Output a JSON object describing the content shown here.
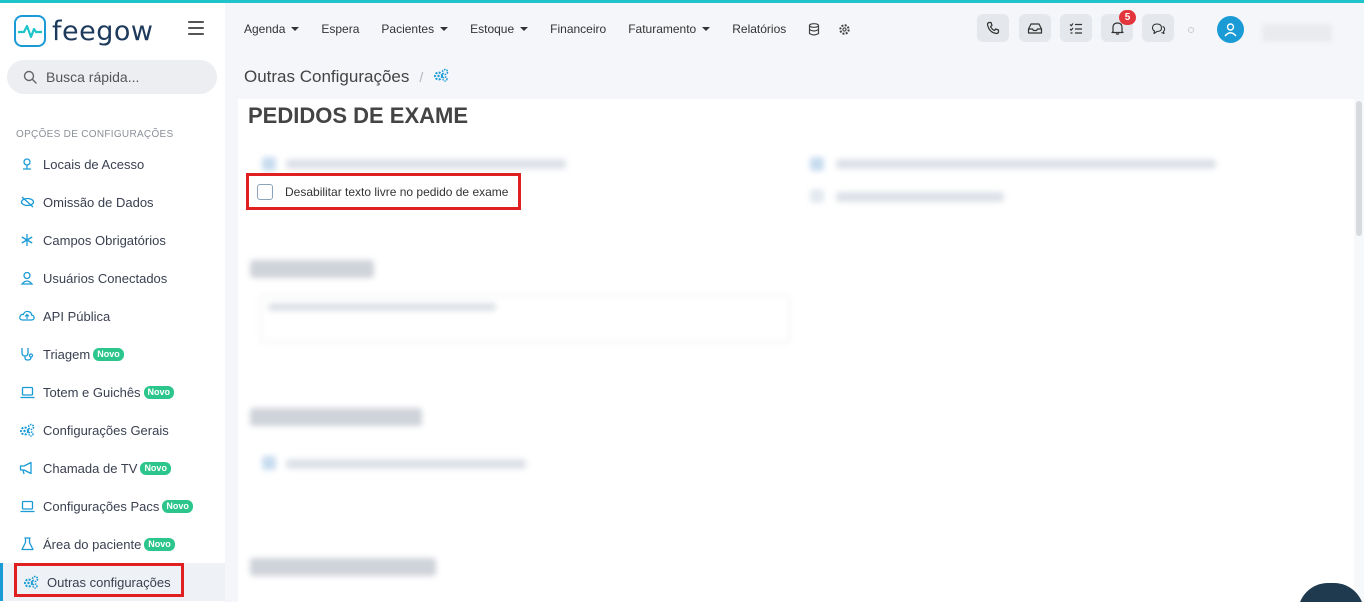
{
  "app": {
    "name": "feegow"
  },
  "sidebar": {
    "search_placeholder": "Busca rápida...",
    "section_title": "OPÇÕES DE CONFIGURAÇÕES",
    "items": [
      {
        "label": "Locais de Acesso",
        "icon": "location-pin-icon",
        "badge": ""
      },
      {
        "label": "Omissão de Dados",
        "icon": "eye-slash-icon",
        "badge": ""
      },
      {
        "label": "Campos Obrigatórios",
        "icon": "asterisk-icon",
        "badge": ""
      },
      {
        "label": "Usuários Conectados",
        "icon": "user-icon",
        "badge": ""
      },
      {
        "label": "API Pública",
        "icon": "cloud-upload-icon",
        "badge": ""
      },
      {
        "label": "Triagem",
        "icon": "stethoscope-icon",
        "badge": "Novo"
      },
      {
        "label": "Totem e Guichês",
        "icon": "laptop-icon",
        "badge": "Novo"
      },
      {
        "label": "Configurações Gerais",
        "icon": "gears-icon",
        "badge": ""
      },
      {
        "label": "Chamada de TV",
        "icon": "megaphone-icon",
        "badge": "Novo"
      },
      {
        "label": "Configurações Pacs",
        "icon": "laptop-icon",
        "badge": "Novo"
      },
      {
        "label": "Área do paciente",
        "icon": "flask-icon",
        "badge": "Novo"
      },
      {
        "label": "Outras configurações",
        "icon": "gears-icon",
        "badge": ""
      }
    ]
  },
  "topnav": {
    "items": [
      {
        "label": "Agenda",
        "dropdown": true
      },
      {
        "label": "Espera",
        "dropdown": false
      },
      {
        "label": "Pacientes",
        "dropdown": true
      },
      {
        "label": "Estoque",
        "dropdown": true
      },
      {
        "label": "Financeiro",
        "dropdown": false
      },
      {
        "label": "Faturamento",
        "dropdown": true
      },
      {
        "label": "Relatórios",
        "dropdown": false
      }
    ],
    "notification_count": "5"
  },
  "breadcrumb": {
    "title": "Outras Configurações",
    "separator": "/"
  },
  "content": {
    "section_heading": "PEDIDOS DE EXAME",
    "highlight_checkbox_label": "Desabilitar texto livre no pedido de exame"
  },
  "colors": {
    "accent": "#1b9bd6",
    "highlight": "#e02020",
    "new_badge": "#2cc68c",
    "notification": "#e2363c"
  }
}
